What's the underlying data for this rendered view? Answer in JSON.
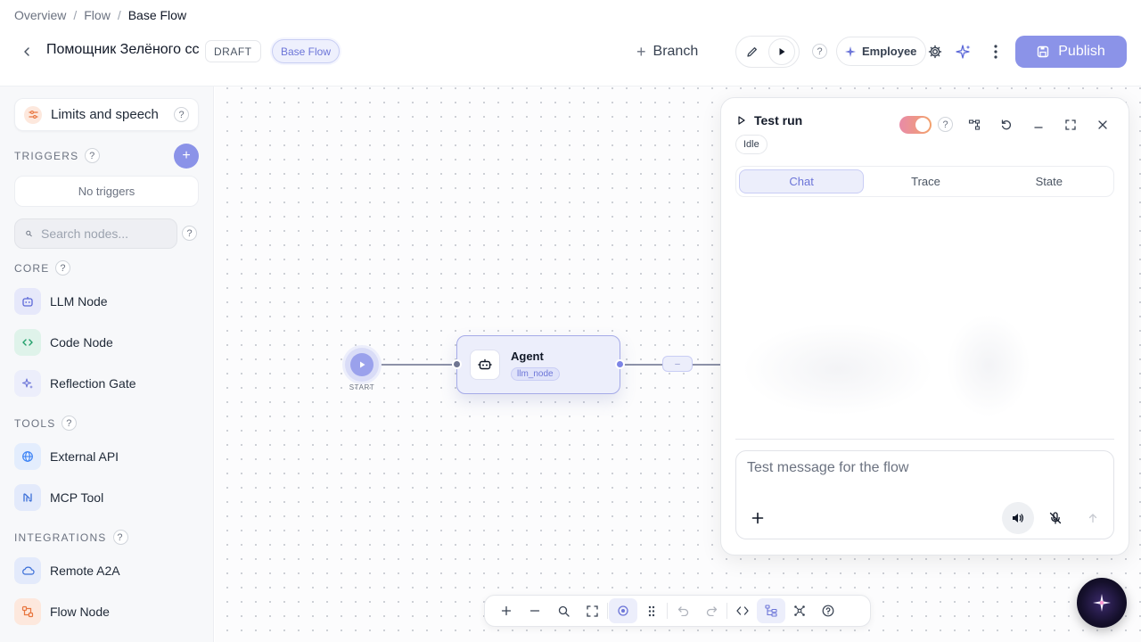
{
  "breadcrumb": {
    "items": [
      "Overview",
      "Flow"
    ],
    "current": "Base Flow",
    "separator": "/"
  },
  "header": {
    "flow_title": "Помощник Зелёного сс",
    "status_badge": "DRAFT",
    "flow_pill": "Base Flow",
    "branch_label": "Branch",
    "help": "?",
    "employee_label": "Employee",
    "publish_label": "Publish"
  },
  "sidebar": {
    "limits_label": "Limits and speech",
    "help": "?",
    "triggers": {
      "title": "TRIGGERS",
      "add": "+",
      "empty_text": "No triggers"
    },
    "search": {
      "placeholder": "Search nodes..."
    },
    "core": {
      "title": "CORE",
      "items": [
        {
          "label": "LLM Node",
          "icon": "robot-icon",
          "color": "#5b67d8"
        },
        {
          "label": "Code Node",
          "icon": "code-icon",
          "color": "#22a06b"
        },
        {
          "label": "Reflection Gate",
          "icon": "sparkles-icon",
          "color": "#6c75d8"
        }
      ]
    },
    "tools": {
      "title": "TOOLS",
      "items": [
        {
          "label": "External API",
          "icon": "globe-icon",
          "color": "#3b82f6"
        },
        {
          "label": "MCP Tool",
          "icon": "mcp-icon",
          "color": "#3b6fd8"
        }
      ]
    },
    "integrations": {
      "title": "INTEGRATIONS",
      "items": [
        {
          "label": "Remote A2A",
          "icon": "cloud-icon",
          "color": "#3b6fd8"
        },
        {
          "label": "Flow Node",
          "icon": "flow-icon",
          "color": "#e8763f"
        }
      ]
    }
  },
  "canvas": {
    "start_label": "START",
    "agent": {
      "title": "Agent",
      "type": "llm_node"
    },
    "edge_pill": "–"
  },
  "test_run": {
    "title": "Test run",
    "status": "Idle",
    "help": "?",
    "tabs": [
      "Chat",
      "Trace",
      "State"
    ],
    "active_tab": "Chat",
    "input_placeholder": "Test message for the flow"
  },
  "colors": {
    "accent": "#8b93e8",
    "accent_text": "#6c75d8",
    "canvas_dot": "#c9ccd3"
  }
}
